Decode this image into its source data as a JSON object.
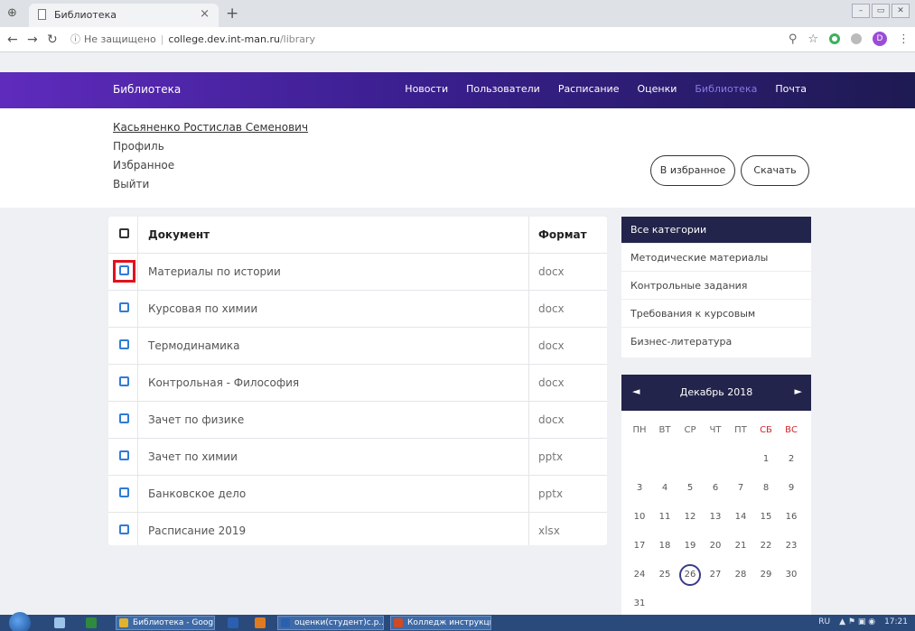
{
  "browser": {
    "tab_title": "Библиотека",
    "tab_close": "×",
    "new_tab": "+",
    "insecure_label": "Не защищено",
    "url_host": "college.dev.int-man.ru",
    "url_path": "/library",
    "profile_letter": "D",
    "window_buttons": [
      "–",
      "▭",
      "✕"
    ]
  },
  "site": {
    "brand": "Библиотека",
    "menu": [
      "Новости",
      "Пользователи",
      "Расписание",
      "Оценки",
      "Библиотека",
      "Почта"
    ],
    "active_menu_color": "#8a78e8"
  },
  "user": {
    "name": "Касьяненко Ростислав Семенович",
    "links": [
      "Профиль",
      "Избранное",
      "Выйти"
    ],
    "favorite_button": "В избранное",
    "download_button": "Скачать"
  },
  "documents": {
    "header": {
      "name": "Документ",
      "format": "Формат"
    },
    "rows": [
      {
        "name": "Материалы по истории",
        "format": "docx",
        "selected": true
      },
      {
        "name": "Курсовая по химии",
        "format": "docx"
      },
      {
        "name": "Термодинамика",
        "format": "docx"
      },
      {
        "name": "Контрольная - Философия",
        "format": "docx"
      },
      {
        "name": "Зачет по физике",
        "format": "docx"
      },
      {
        "name": "Зачет по химии",
        "format": "pptx"
      },
      {
        "name": "Банковское дело",
        "format": "pptx"
      },
      {
        "name": "Расписание 2019",
        "format": "xlsx"
      }
    ]
  },
  "categories": [
    "Все категории",
    "Методические материалы",
    "Контрольные задания",
    "Требования к курсовым",
    "Бизнес-литература"
  ],
  "calendar": {
    "title": "Декабрь 2018",
    "prev": "◄",
    "next": "►",
    "weekdays": [
      "ПН",
      "ВТ",
      "СР",
      "ЧТ",
      "ПТ",
      "СБ",
      "ВС"
    ],
    "weeks": [
      [
        "",
        "",
        "",
        "",
        "",
        "1",
        "2"
      ],
      [
        "3",
        "4",
        "5",
        "6",
        "7",
        "8",
        "9"
      ],
      [
        "10",
        "11",
        "12",
        "13",
        "14",
        "15",
        "16"
      ],
      [
        "17",
        "18",
        "19",
        "20",
        "21",
        "22",
        "23"
      ],
      [
        "24",
        "25",
        "26",
        "27",
        "28",
        "29",
        "30"
      ],
      [
        "31",
        "",
        "",
        "",
        "",
        "",
        ""
      ]
    ],
    "today": "26"
  },
  "taskbar": {
    "buttons": [
      "Библиотека - Googl...",
      "оценки(студент)с.р...",
      "Колледж инструкци..."
    ],
    "lang": "RU",
    "time": "17:21"
  }
}
